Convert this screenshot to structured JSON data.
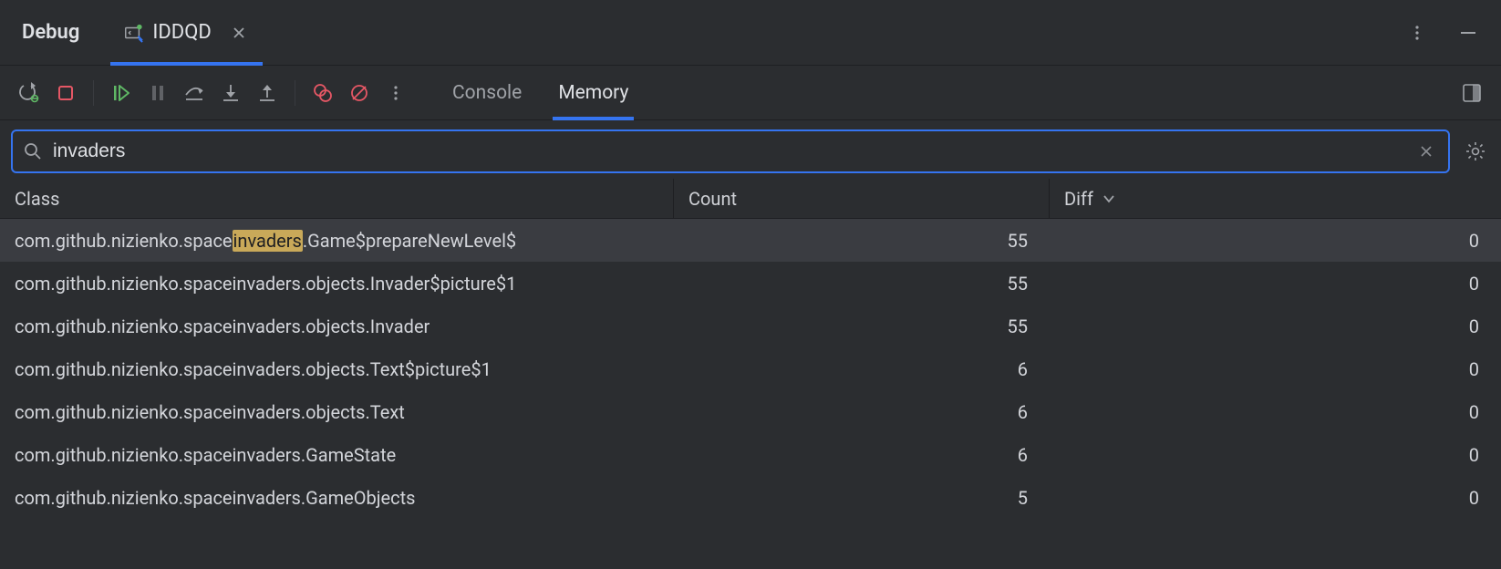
{
  "topbar": {
    "title": "Debug",
    "run_tab_label": "IDDQD"
  },
  "toolbar_icons": {
    "rerun": "rerun-icon",
    "stop": "stop-icon",
    "resume": "resume-icon",
    "pause": "pause-icon",
    "step_over": "step-over-icon",
    "step_into": "step-into-icon",
    "step_out": "step-out-icon",
    "view_breakpoints": "view-breakpoints-icon",
    "mute_breakpoints": "mute-breakpoints-icon",
    "more": "more-icon"
  },
  "subtabs": {
    "console": "Console",
    "memory": "Memory",
    "active": "memory"
  },
  "search": {
    "value": "invaders",
    "highlight": "invaders"
  },
  "columns": {
    "class": "Class",
    "count": "Count",
    "diff": "Diff"
  },
  "rows": [
    {
      "class_pre": "com.github.nizienko.space",
      "class_hl": "invaders",
      "class_post": ".Game$prepareNewLevel$",
      "count": "55",
      "diff": "0",
      "selected": true
    },
    {
      "class_pre": "com.github.nizienko.spaceinvaders.objects.Invader$picture$1",
      "class_hl": "",
      "class_post": "",
      "count": "55",
      "diff": "0",
      "selected": false
    },
    {
      "class_pre": "com.github.nizienko.spaceinvaders.objects.Invader",
      "class_hl": "",
      "class_post": "",
      "count": "55",
      "diff": "0",
      "selected": false
    },
    {
      "class_pre": "com.github.nizienko.spaceinvaders.objects.Text$picture$1",
      "class_hl": "",
      "class_post": "",
      "count": "6",
      "diff": "0",
      "selected": false
    },
    {
      "class_pre": "com.github.nizienko.spaceinvaders.objects.Text",
      "class_hl": "",
      "class_post": "",
      "count": "6",
      "diff": "0",
      "selected": false
    },
    {
      "class_pre": "com.github.nizienko.spaceinvaders.GameState",
      "class_hl": "",
      "class_post": "",
      "count": "6",
      "diff": "0",
      "selected": false
    },
    {
      "class_pre": "com.github.nizienko.spaceinvaders.GameObjects",
      "class_hl": "",
      "class_post": "",
      "count": "5",
      "diff": "0",
      "selected": false
    }
  ]
}
